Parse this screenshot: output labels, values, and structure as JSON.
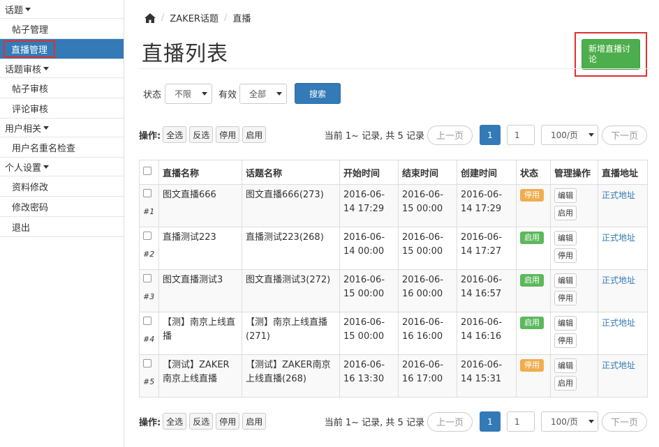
{
  "sidebar": {
    "groups": [
      {
        "label": "话题",
        "items": [
          "帖子管理",
          "直播管理"
        ]
      },
      {
        "label": "话题审核",
        "items": [
          "帖子审核",
          "评论审核"
        ]
      },
      {
        "label": "用户相关",
        "items": [
          "用户名重名检查"
        ]
      },
      {
        "label": "个人设置",
        "items": [
          "资料修改",
          "修改密码",
          "退出"
        ]
      }
    ],
    "active_item": "直播管理"
  },
  "breadcrumb": {
    "home": "home-icon",
    "level1": "ZAKER话题",
    "level2": "直播"
  },
  "page_title": "直播列表",
  "add_button": "新增直播讨论",
  "filter": {
    "status_label": "状态",
    "status_value": "不限",
    "valid_label": "有效",
    "valid_value": "全部",
    "search_button": "搜索"
  },
  "ops": {
    "label": "操作:",
    "select_all": "全选",
    "invert": "反选",
    "disable": "停用",
    "enable": "启用"
  },
  "pager": {
    "info": "当前 1~ 记录, 共 5 记录",
    "prev": "上一页",
    "current": "1",
    "input": "1",
    "page_size": "100/页",
    "next": "下一页"
  },
  "table": {
    "headers": [
      "直播名称",
      "话题名称",
      "开始时间",
      "结束时间",
      "创建时间",
      "状态",
      "管理操作",
      "直播地址"
    ],
    "rows": [
      {
        "num": "#1",
        "name": "图文直播666",
        "topic": "图文直播666(273)",
        "start": "2016-06-14 17:29",
        "end": "2016-06-15 00:00",
        "created": "2016-06-14 17:29",
        "status": "停用",
        "status_color": "#f0ad4e",
        "edit": "编辑",
        "toggle": "启用",
        "url": "正式地址"
      },
      {
        "num": "#2",
        "name": "直播测试223",
        "topic": "直播测试223(268)",
        "start": "2016-06-14 00:00",
        "end": "2016-06-15 00:00",
        "created": "2016-06-14 17:27",
        "status": "启用",
        "status_color": "#5cb85c",
        "edit": "编辑",
        "toggle": "停用",
        "url": "正式地址"
      },
      {
        "num": "#3",
        "name": "图文直播测试3",
        "topic": "图文直播测试3(272)",
        "start": "2016-06-15 00:00",
        "end": "2016-06-16 00:00",
        "created": "2016-06-14 16:57",
        "status": "启用",
        "status_color": "#5cb85c",
        "edit": "编辑",
        "toggle": "停用",
        "url": "正式地址"
      },
      {
        "num": "#4",
        "name": "【测】南京上线直播",
        "topic": "【测】南京上线直播(271)",
        "start": "2016-06-15 00:00",
        "end": "2016-06-16 16:00",
        "created": "2016-06-14 16:16",
        "status": "启用",
        "status_color": "#5cb85c",
        "edit": "编辑",
        "toggle": "停用",
        "url": "正式地址"
      },
      {
        "num": "#5",
        "name": "【测试】ZAKER南京上线直播",
        "topic": "【测试】ZAKER南京上线直播(268)",
        "start": "2016-06-16 13:30",
        "end": "2016-06-16 17:00",
        "created": "2016-06-14 15:31",
        "status": "停用",
        "status_color": "#f0ad4e",
        "edit": "编辑",
        "toggle": "启用",
        "url": "正式地址"
      }
    ]
  }
}
